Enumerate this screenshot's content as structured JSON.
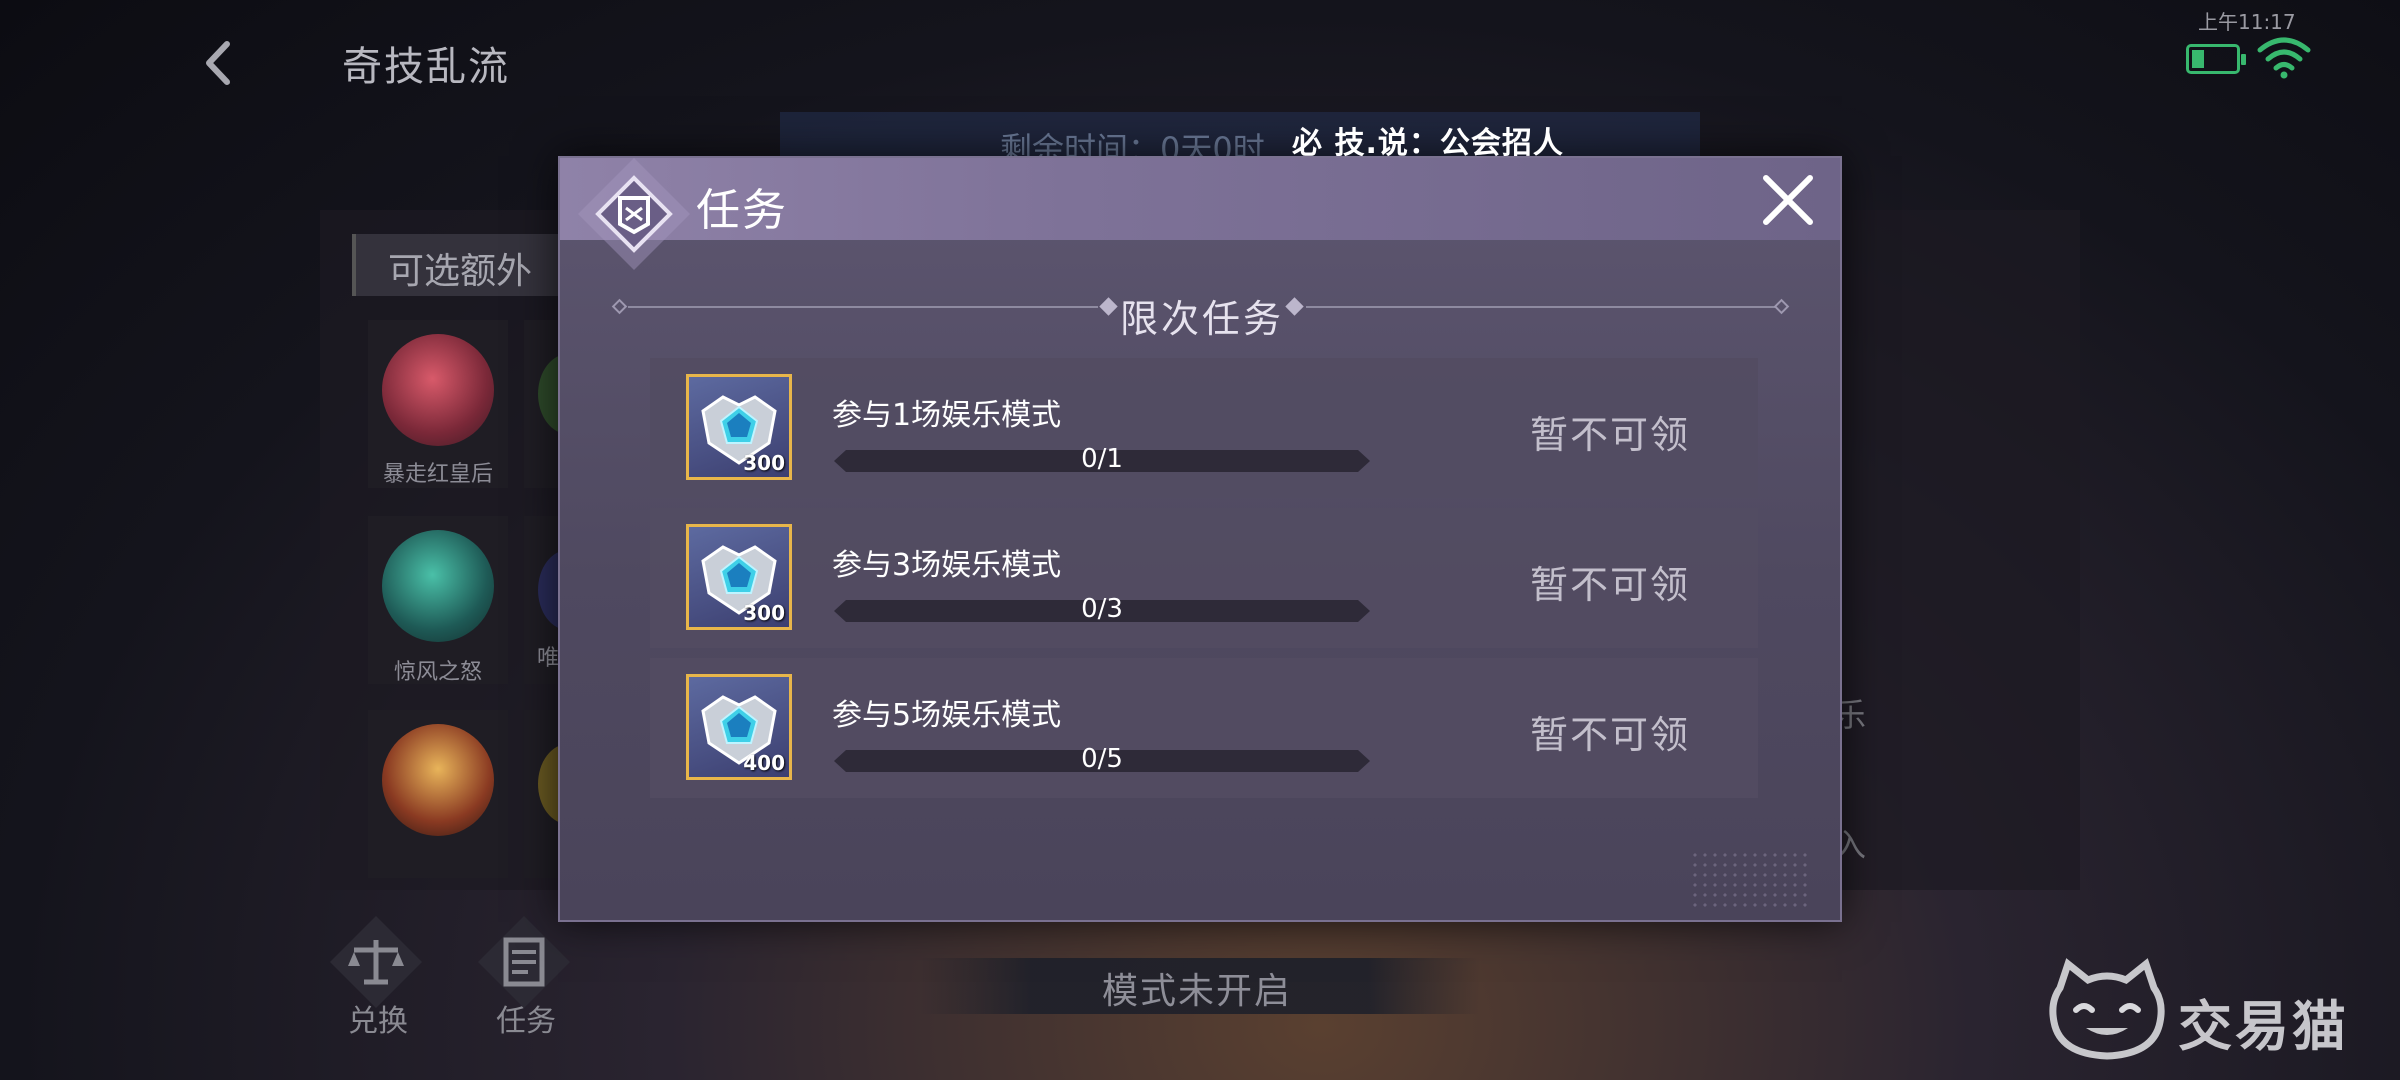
{
  "header": {
    "title": "奇技乱流",
    "back_icon": "back-arrow-icon"
  },
  "status_bar": {
    "time": "上午11:17",
    "battery_icon": "battery-icon",
    "wifi_icon": "wifi-icon"
  },
  "background": {
    "timer_text": "剩余时间：0天0时",
    "extra_header": "可选额外",
    "heroes": [
      {
        "name": "暴走红皇后"
      },
      {
        "name": ""
      },
      {
        "name": "惊风之怒"
      },
      {
        "name": "唯"
      },
      {
        "name": ""
      },
      {
        "name": ""
      }
    ],
    "right_glyphs": [
      "乐",
      "入"
    ],
    "bottom_buttons": [
      {
        "label": "兑换",
        "icon": "scale-icon"
      },
      {
        "label": "任务",
        "icon": "task-list-icon"
      }
    ],
    "mode_banner": "模式未开启",
    "marquee": "必 技.说：公会招人"
  },
  "modal": {
    "title": "任务",
    "emblem_icon": "task-emblem-icon",
    "close_icon": "close-icon",
    "section_title": "限次任务",
    "tasks": [
      {
        "name": "参与1场娱乐模式",
        "progress_text": "0/1",
        "progress": 0,
        "reward_amount": "300",
        "status": "暂不可领"
      },
      {
        "name": "参与3场娱乐模式",
        "progress_text": "0/3",
        "progress": 0,
        "reward_amount": "300",
        "status": "暂不可领"
      },
      {
        "name": "参与5场娱乐模式",
        "progress_text": "0/5",
        "progress": 0,
        "reward_amount": "400",
        "status": "暂不可领"
      }
    ]
  },
  "watermark": {
    "text": "交易猫"
  },
  "colors": {
    "reward_border": "#e8b64a",
    "modal_header": "#8f82a8",
    "modal_body": "#55506a",
    "battery_green": "#38b86e"
  }
}
